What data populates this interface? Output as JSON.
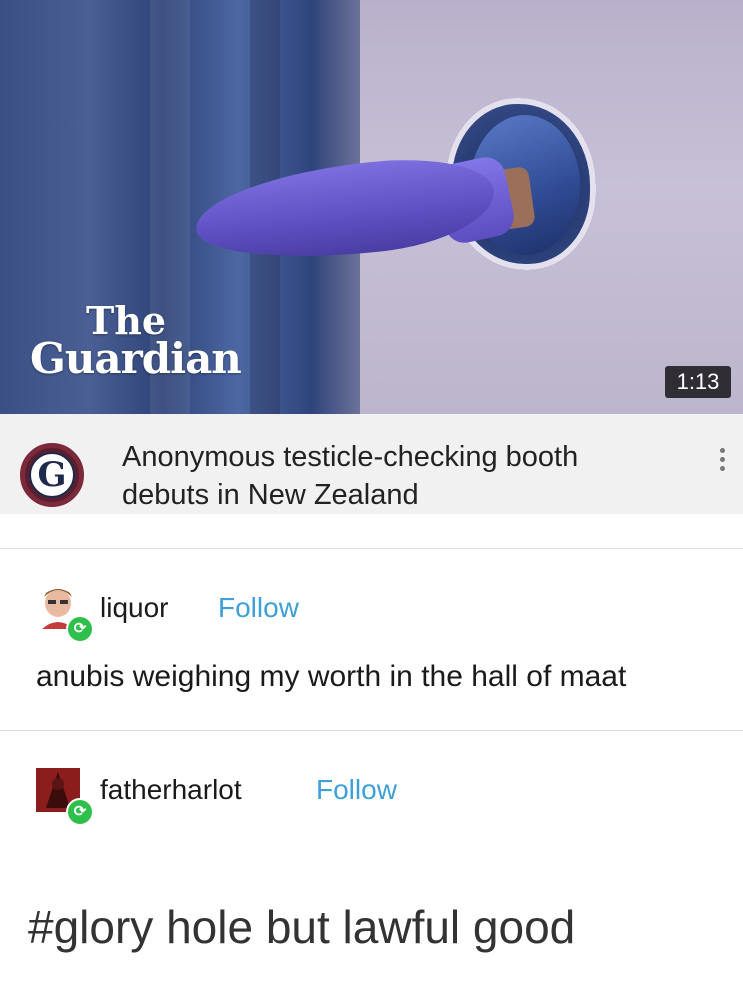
{
  "video": {
    "logo_line1": "The",
    "logo_line2": "Guardian",
    "duration": "1:13"
  },
  "caption": {
    "channel_initial": "G",
    "title": "Anonymous testicle-checking booth debuts in New Zealand"
  },
  "posts": [
    {
      "username": "liquor",
      "follow_label": "Follow",
      "text": "anubis weighing my worth in the hall of maat"
    },
    {
      "username": "fatherharlot",
      "follow_label": "Follow",
      "tag_text": "#glory hole but lawful good"
    }
  ],
  "colors": {
    "follow": "#3ea0d8",
    "reblog_badge": "#2fbf4b",
    "glove": "#6a5bd6"
  },
  "icons": [
    "more-vert-icon",
    "reblog-icon"
  ]
}
